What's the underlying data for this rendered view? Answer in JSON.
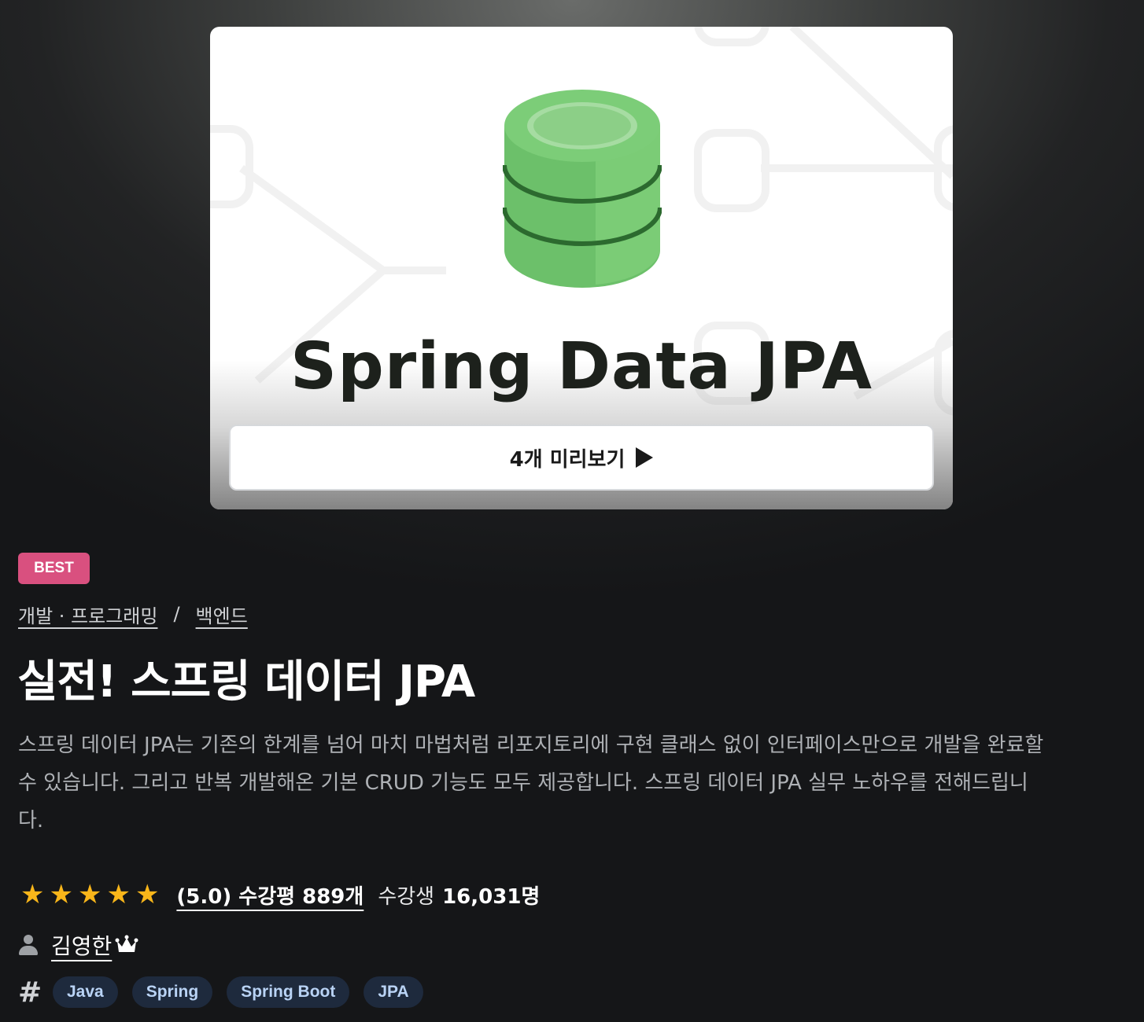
{
  "thumbnail": {
    "title": "Spring Data JPA",
    "preview_button": "4개 미리보기"
  },
  "badge": "BEST",
  "breadcrumb": {
    "category": "개발 · 프로그래밍",
    "separator": "/",
    "subcategory": "백엔드"
  },
  "course": {
    "title": "실전! 스프링 데이터 JPA",
    "description": "스프링 데이터 JPA는 기존의 한계를 넘어 마치 마법처럼 리포지토리에 구현 클래스 없이 인터페이스만으로 개발을 완료할 수 있습니다. 그리고 반복 개발해온 기본 CRUD 기능도 모두 제공합니다. 스프링 데이터 JPA 실무 노하우를 전해드립니다."
  },
  "rating": {
    "stars": 5,
    "review_text": "(5.0) 수강평 889개",
    "students_label": "수강생",
    "students_count": "16,031명"
  },
  "instructor": {
    "name": "김영한"
  },
  "tags": [
    "Java",
    "Spring",
    "Spring Boot",
    "JPA"
  ],
  "colors": {
    "badge": "#d9507f",
    "star": "#f9b61a",
    "tag_bg": "#1e2a3d",
    "tag_text": "#b9d3f5",
    "db_green": "#6cc06a"
  },
  "icons": {
    "preview": "play-icon",
    "rating": "star-icon",
    "instructor": "person-icon",
    "instructor_badge": "crown-icon",
    "tags": "hash-icon"
  }
}
